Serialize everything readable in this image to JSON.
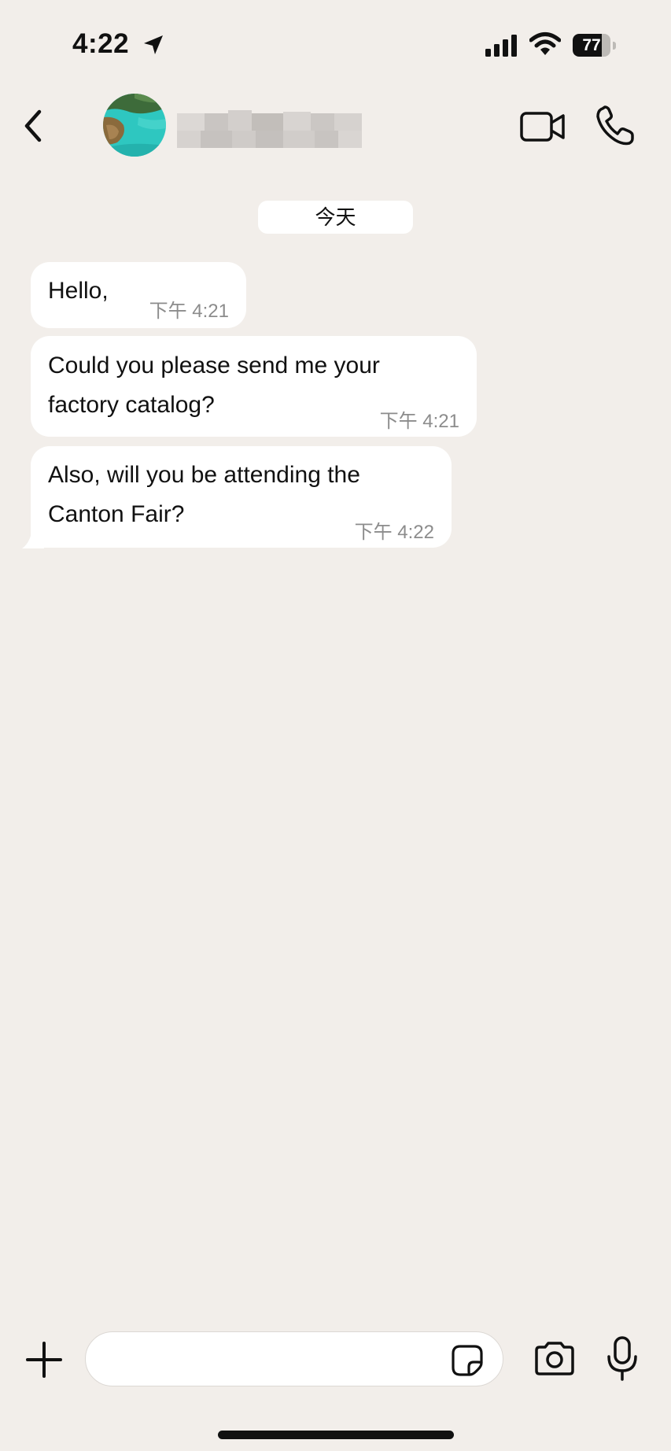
{
  "status_bar": {
    "time": "4:22",
    "battery": "77",
    "battery_level": 0.77
  },
  "header": {
    "back_icon": "chevron-left-icon",
    "contact_name": "",
    "video_icon": "video-camera-icon",
    "call_icon": "phone-icon"
  },
  "chat": {
    "date_label": "今天",
    "messages": [
      {
        "lines": [
          "Hello,"
        ],
        "time": "下午 4:21"
      },
      {
        "lines": [
          "Could you please send me your",
          "factory catalog?"
        ],
        "time": "下午 4:21"
      },
      {
        "lines": [
          "Also, will you be attending the",
          "Canton Fair?"
        ],
        "time": "下午 4:22"
      }
    ]
  },
  "composer": {
    "input_value": "",
    "plus_icon": "plus-icon",
    "sticker_icon": "sticker-icon",
    "camera_icon": "camera-icon",
    "mic_icon": "microphone-icon"
  },
  "colors": {
    "background": "#f2eeea",
    "bubble": "#ffffff",
    "timestamp": "#8c8c8c"
  }
}
